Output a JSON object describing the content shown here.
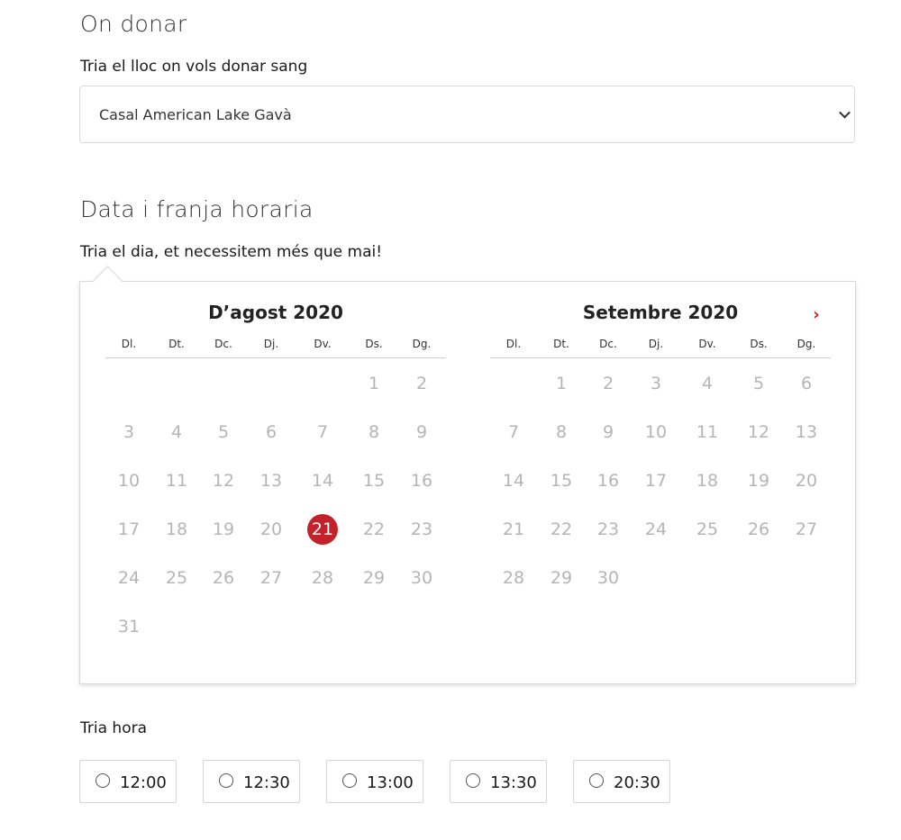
{
  "location": {
    "heading": "On donar",
    "label": "Tria el lloc on vols donar sang",
    "selected": "Casal American Lake Gavà"
  },
  "schedule": {
    "heading": "Data i franja horaria",
    "label": "Tria el dia, et necessitem més que mai!"
  },
  "calendar": {
    "weekdays": [
      "Dl.",
      "Dt.",
      "Dc.",
      "Dj.",
      "Dv.",
      "Ds.",
      "Dg."
    ],
    "next_label": "›",
    "months": [
      {
        "title": "D’agost 2020",
        "first_weekday": 5,
        "days": 31,
        "selected": 21
      },
      {
        "title": "Setembre 2020",
        "first_weekday": 1,
        "days": 30,
        "selected": null
      }
    ]
  },
  "hours": {
    "label": "Tria hora",
    "options": [
      "12:00",
      "12:30",
      "13:00",
      "13:30",
      "20:30"
    ]
  }
}
